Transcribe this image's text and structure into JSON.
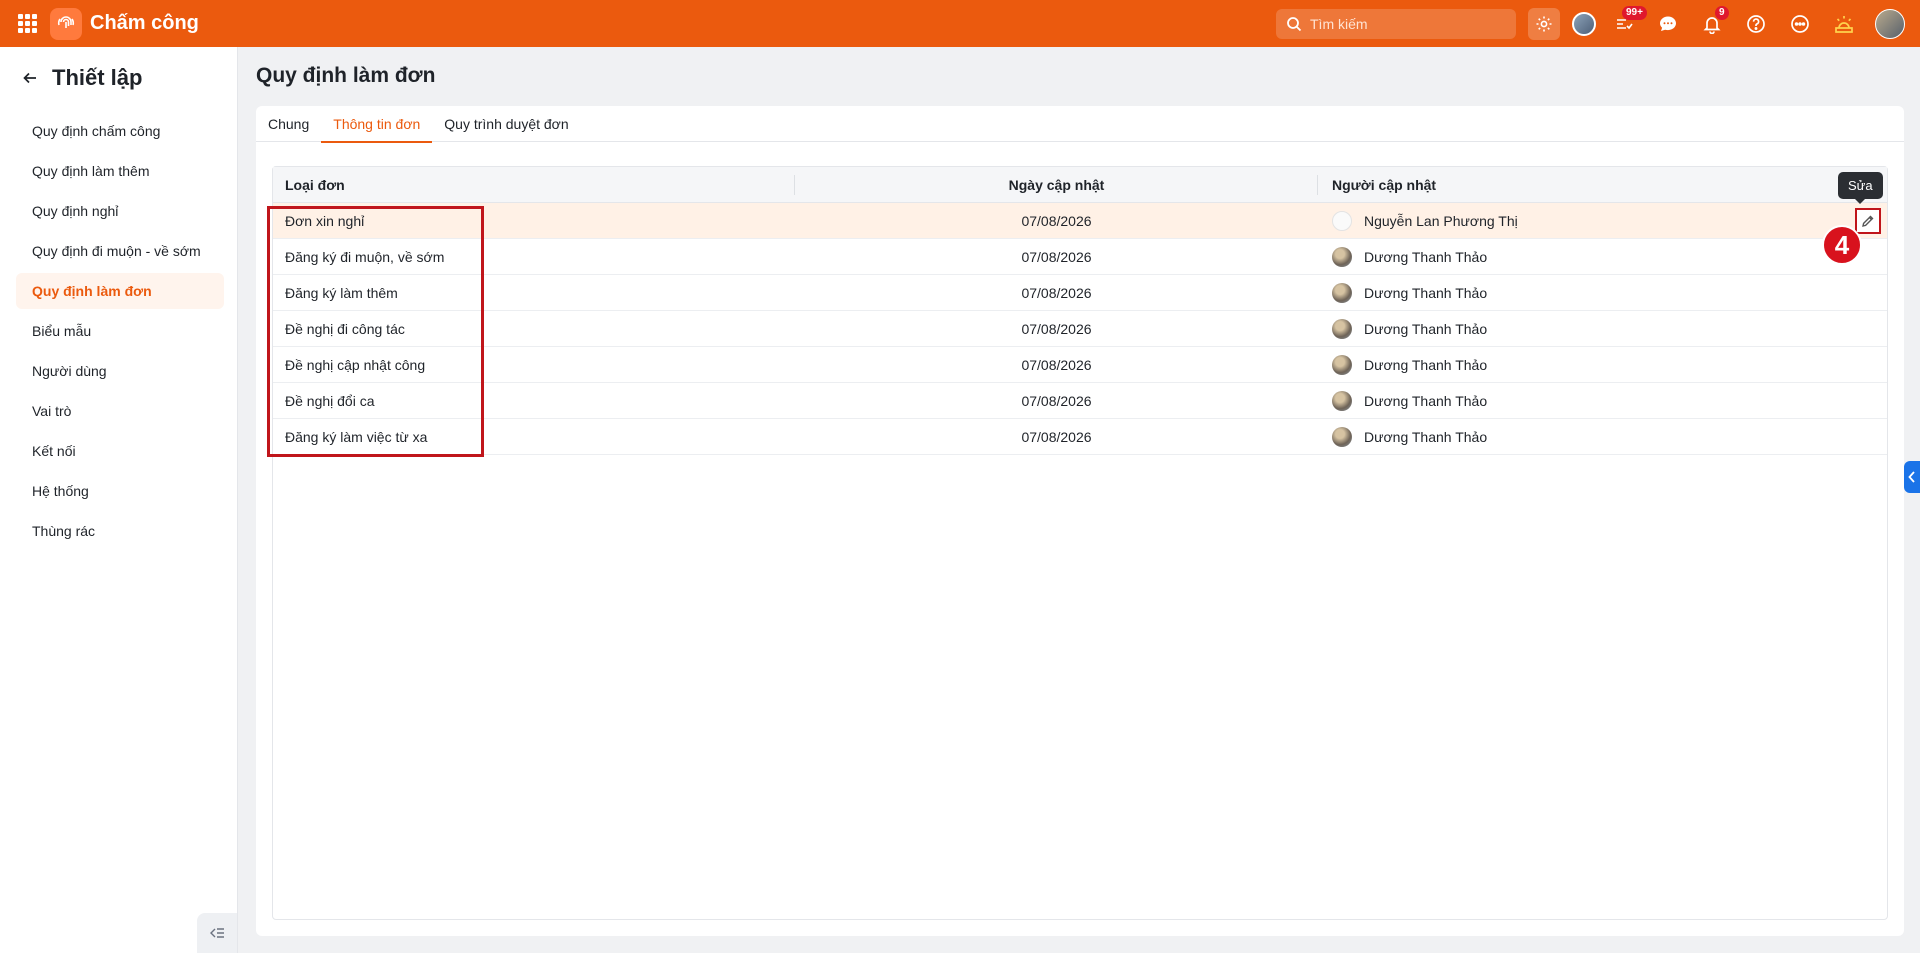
{
  "app": {
    "title": "Chấm công"
  },
  "topbar": {
    "search_placeholder": "Tìm kiếm",
    "badges": {
      "tasks": "99+",
      "notifications": "9"
    }
  },
  "sidebar": {
    "title": "Thiết lập",
    "items": [
      {
        "label": "Quy định chấm công",
        "active": false
      },
      {
        "label": "Quy định làm thêm",
        "active": false
      },
      {
        "label": "Quy định nghỉ",
        "active": false
      },
      {
        "label": "Quy định đi muộn - về sớm",
        "active": false
      },
      {
        "label": "Quy định làm đơn",
        "active": true
      },
      {
        "label": "Biểu mẫu",
        "active": false
      },
      {
        "label": "Người dùng",
        "active": false
      },
      {
        "label": "Vai trò",
        "active": false
      },
      {
        "label": "Kết nối",
        "active": false
      },
      {
        "label": "Hệ thống",
        "active": false
      },
      {
        "label": "Thùng rác",
        "active": false
      }
    ]
  },
  "page": {
    "title": "Quy định làm đơn",
    "tabs": [
      {
        "label": "Chung",
        "active": false
      },
      {
        "label": "Thông tin đơn",
        "active": true
      },
      {
        "label": "Quy trình duyệt đơn",
        "active": false
      }
    ]
  },
  "table": {
    "columns": [
      "Loại đơn",
      "Ngày cập nhật",
      "Người cập nhật"
    ],
    "rows": [
      {
        "type": "Đơn xin nghỉ",
        "date": "07/08/2026",
        "user": "Nguyễn Lan Phương Thị"
      },
      {
        "type": "Đăng ký đi muộn, về sớm",
        "date": "07/08/2026",
        "user": "Dương Thanh Thảo"
      },
      {
        "type": "Đăng ký làm thêm",
        "date": "07/08/2026",
        "user": "Dương Thanh Thảo"
      },
      {
        "type": "Đề nghị đi công tác",
        "date": "07/08/2026",
        "user": "Dương Thanh Thảo"
      },
      {
        "type": "Đề nghị cập nhật công",
        "date": "07/08/2026",
        "user": "Dương Thanh Thảo"
      },
      {
        "type": "Đề nghị đổi ca",
        "date": "07/08/2026",
        "user": "Dương Thanh Thảo"
      },
      {
        "type": "Đăng ký làm việc từ xa",
        "date": "07/08/2026",
        "user": "Dương Thanh Thảo"
      }
    ],
    "edit_tooltip": "Sửa"
  },
  "annotation": {
    "step": "4"
  },
  "colors": {
    "brand": "#eb5a0e",
    "highlight_row": "#fff1e6",
    "annotation_red": "#c0151b"
  }
}
